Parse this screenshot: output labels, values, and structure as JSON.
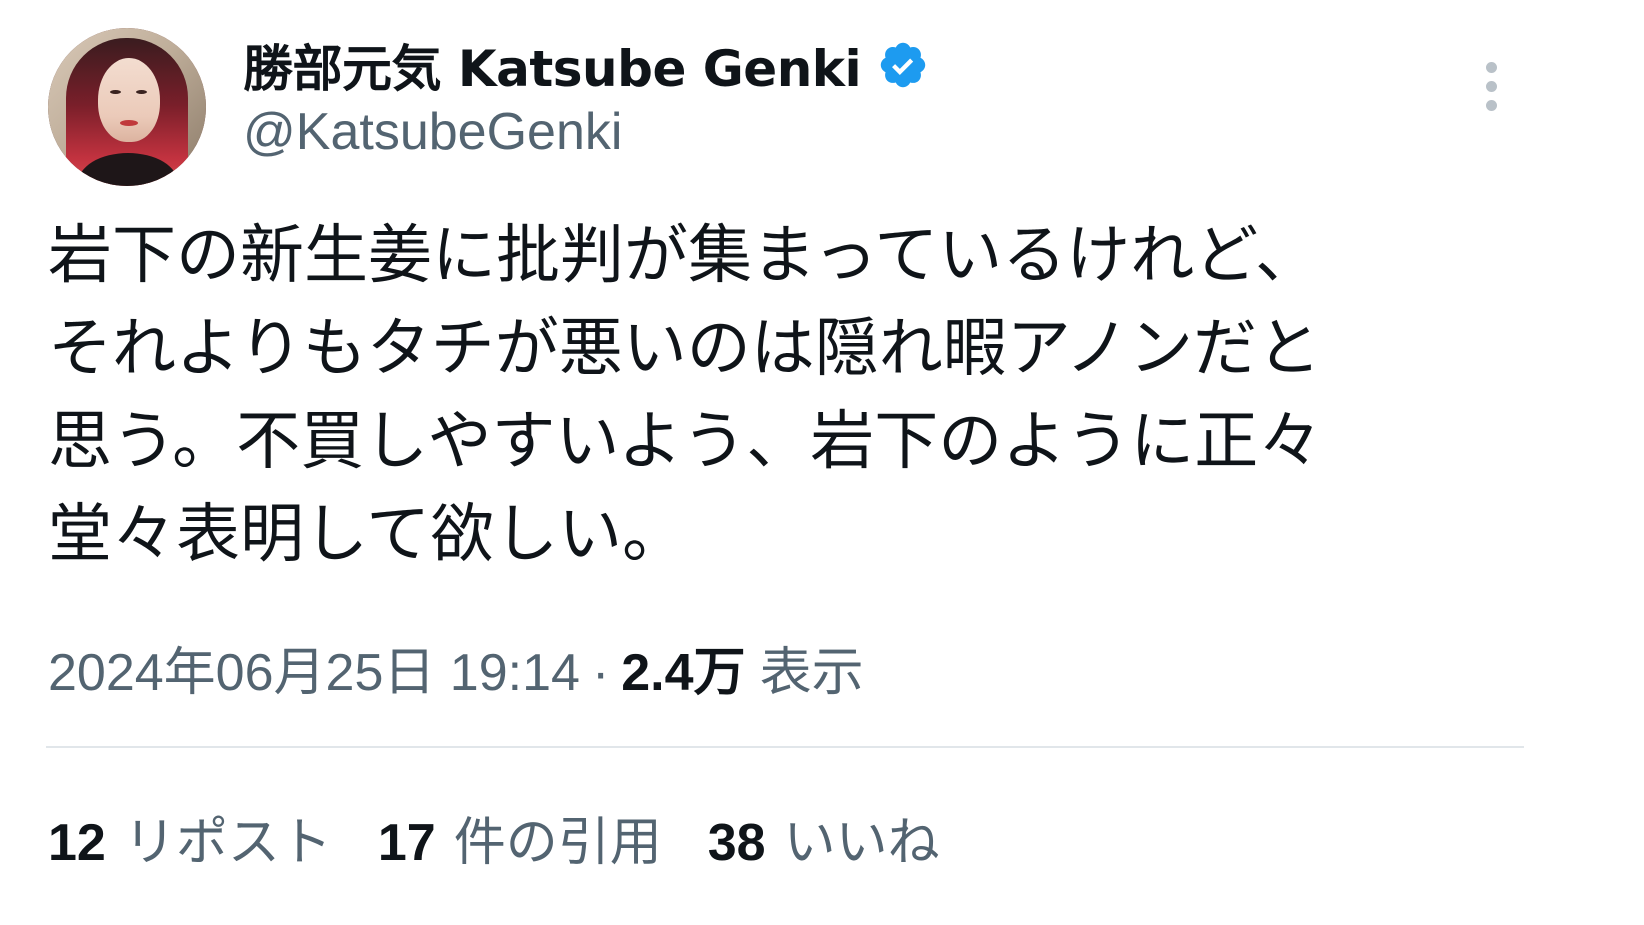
{
  "author": {
    "display_name": "勝部元気 Katsube Genki",
    "handle": "@KatsubeGenki",
    "verified_icon": "verified-badge-icon",
    "avatar_icon": "profile-photo"
  },
  "menu_icon": "more-options-icon",
  "tweet": {
    "text": "岩下の新生姜に批判が集まっているけれど、\nそれよりもタチが悪いのは隠れ暇アノンだと\n思う。不買しやすいよう、岩下のように正々\n堂々表明して欲しい。"
  },
  "meta": {
    "timestamp": "2024年06月25日 19:14",
    "separator": "·",
    "views_count": "2.4万",
    "views_label": "表示"
  },
  "stats": [
    {
      "count": "12",
      "label": "リポスト"
    },
    {
      "count": "17",
      "label": "件の引用"
    },
    {
      "count": "38",
      "label": "いいね"
    }
  ],
  "colors": {
    "verified_blue": "#1d9bf0",
    "text_primary": "#0f1419",
    "text_secondary": "#536471",
    "divider": "#e1e6ea"
  }
}
